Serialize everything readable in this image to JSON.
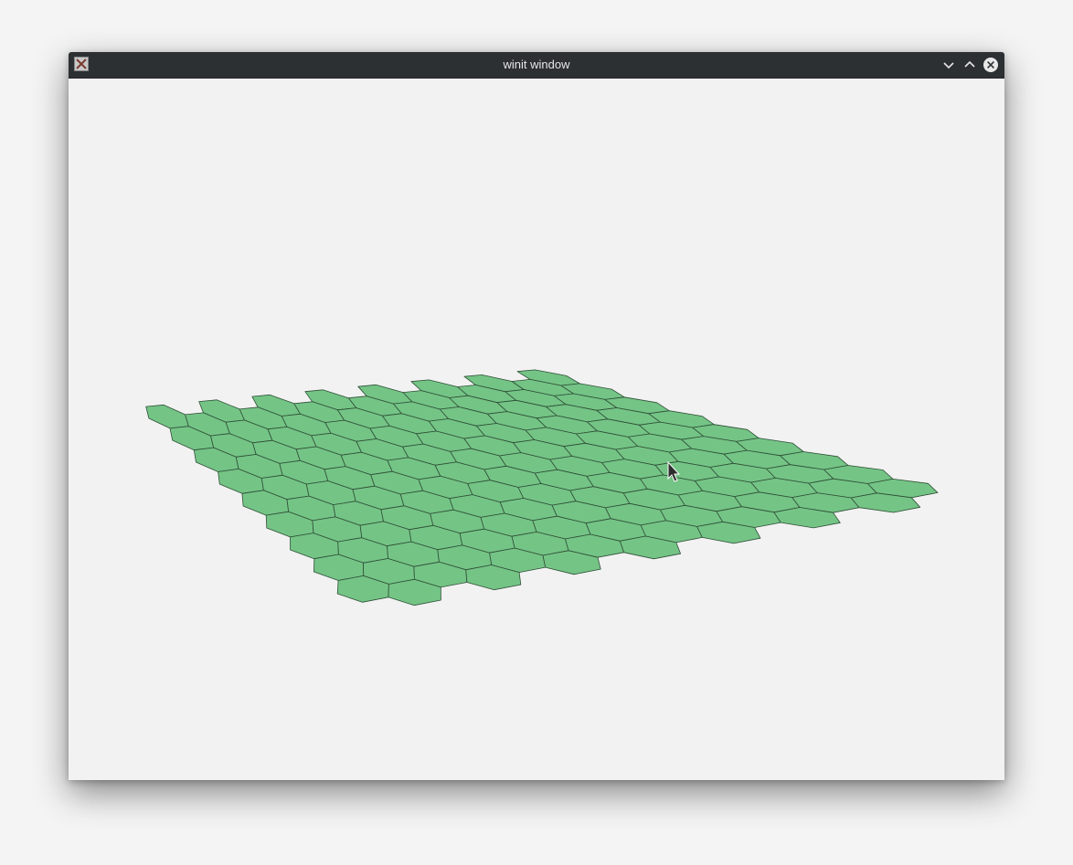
{
  "window": {
    "title": "winit window"
  },
  "scene": {
    "background_color": "#f2f2f2",
    "tile_color": "#74c486",
    "edge_color": "#2f4f36",
    "grid": {
      "columns": 15,
      "rows": 9,
      "layout": "hexagonal"
    }
  },
  "icons": {
    "app": "x11-app-icon",
    "minimize": "chevron-down-icon",
    "maximize": "chevron-up-icon",
    "close": "close-icon",
    "cursor": "mouse-cursor-icon"
  }
}
